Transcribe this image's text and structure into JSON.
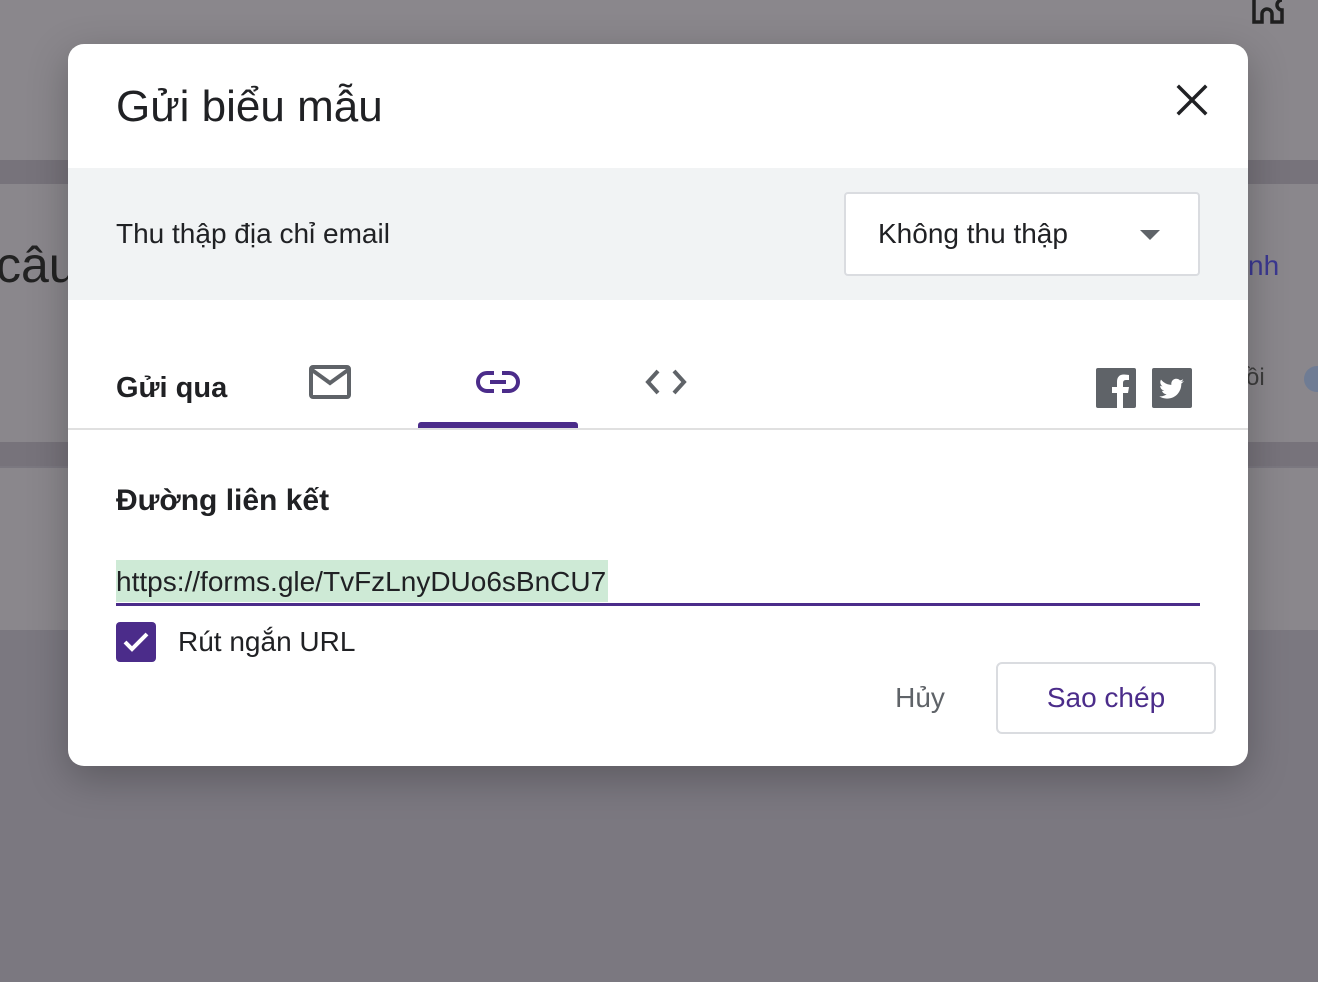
{
  "background": {
    "left_fragment": "câu",
    "right_fragment_1": "nh",
    "right_fragment_2": "ồi",
    "puzzle_icon": "extension-icon"
  },
  "dialog": {
    "title": "Gửi biểu mẫu",
    "close_icon": "close-icon",
    "email_collection": {
      "label": "Thu thập địa chỉ email",
      "selected": "Không thu thập"
    },
    "send_via": {
      "label": "Gửi qua",
      "tabs": [
        {
          "icon": "mail-icon",
          "selected": false
        },
        {
          "icon": "link-icon",
          "selected": true
        },
        {
          "icon": "code-icon",
          "selected": false
        }
      ],
      "social": [
        "facebook-icon",
        "twitter-icon"
      ]
    },
    "link_section": {
      "heading": "Đường liên kết",
      "url": "https://forms.gle/TvFzLnyDUo6sBnCU7",
      "shorten_label": "Rút ngắn URL",
      "shorten_checked": true
    },
    "actions": {
      "cancel": "Hủy",
      "copy": "Sao chép"
    }
  },
  "colors": {
    "accent": "#4b2c8a",
    "highlight": "#ceead6",
    "band": "#f1f3f4",
    "overlay": "#7b7880"
  }
}
